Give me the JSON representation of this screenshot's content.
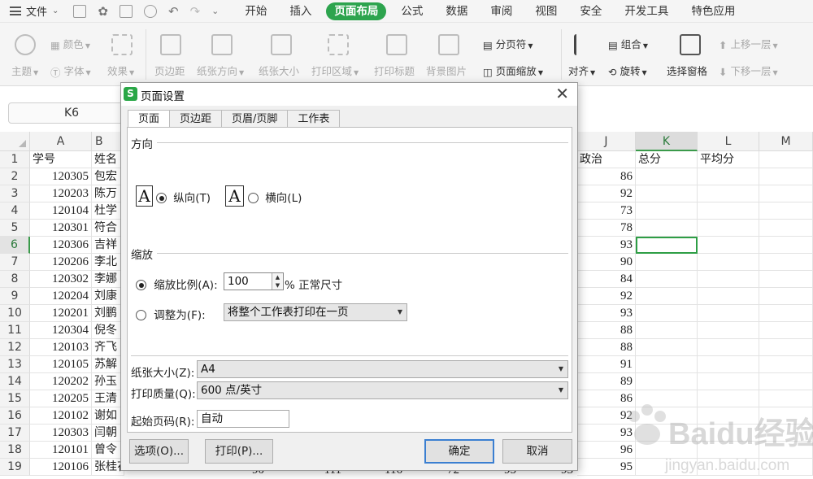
{
  "menubar": {
    "file_label": "文件",
    "tabs": [
      "开始",
      "插入",
      "页面布局",
      "公式",
      "数据",
      "审阅",
      "视图",
      "安全",
      "开发工具",
      "特色应用"
    ],
    "active_tab": "页面布局"
  },
  "ribbon": {
    "theme": "主题",
    "color": "颜色",
    "font": "字体",
    "effect": "效果",
    "margins": "页边距",
    "orientation": "纸张方向",
    "size": "纸张大小",
    "print_area": "打印区域",
    "print_titles": "打印标题",
    "background": "背景图片",
    "page_break": "分页符",
    "page_scale": "页面缩放",
    "align": "对齐",
    "group": "组合",
    "rotate": "旋转",
    "selection_pane": "选择窗格",
    "bring_forward": "上移一层",
    "send_backward": "下移一层"
  },
  "namebox": "K6",
  "sheet": {
    "columns": [
      "A",
      "B",
      "J",
      "K",
      "L",
      "M"
    ],
    "selected_column": "K",
    "selected_row": "6",
    "header_row": {
      "A": "学号",
      "B": "姓名",
      "J": "政治",
      "K": "总分",
      "L": "平均分"
    },
    "rows": [
      {
        "n": "2",
        "id": "120305",
        "name": "包宏",
        "politics": "86"
      },
      {
        "n": "3",
        "id": "120203",
        "name": "陈万",
        "politics": "92"
      },
      {
        "n": "4",
        "id": "120104",
        "name": "杜学",
        "politics": "73"
      },
      {
        "n": "5",
        "id": "120301",
        "name": "符合",
        "politics": "78"
      },
      {
        "n": "6",
        "id": "120306",
        "name": "吉祥",
        "politics": "93"
      },
      {
        "n": "7",
        "id": "120206",
        "name": "李北",
        "politics": "90"
      },
      {
        "n": "8",
        "id": "120302",
        "name": "李娜",
        "politics": "84"
      },
      {
        "n": "9",
        "id": "120204",
        "name": "刘康",
        "politics": "92"
      },
      {
        "n": "10",
        "id": "120201",
        "name": "刘鹏",
        "politics": "93"
      },
      {
        "n": "11",
        "id": "120304",
        "name": "倪冬",
        "politics": "88"
      },
      {
        "n": "12",
        "id": "120103",
        "name": "齐飞",
        "politics": "88"
      },
      {
        "n": "13",
        "id": "120105",
        "name": "苏解",
        "politics": "91"
      },
      {
        "n": "14",
        "id": "120202",
        "name": "孙玉",
        "politics": "89"
      },
      {
        "n": "15",
        "id": "120205",
        "name": "王清",
        "politics": "86"
      },
      {
        "n": "16",
        "id": "120102",
        "name": "谢如",
        "politics": "92"
      },
      {
        "n": "17",
        "id": "120303",
        "name": "闫朝",
        "politics": "93"
      },
      {
        "n": "18",
        "id": "120101",
        "name": "曾令",
        "politics": "96"
      },
      {
        "n": "19",
        "id": "120106",
        "name": "张桂花",
        "politics": "95"
      }
    ],
    "row19_extra": [
      "90",
      "111",
      "116",
      "72",
      "95",
      "93"
    ]
  },
  "dialog": {
    "title": "页面设置",
    "tabs": [
      "页面",
      "页边距",
      "页眉/页脚",
      "工作表"
    ],
    "active_tab": "页面",
    "orientation_section": "方向",
    "portrait": "纵向(T)",
    "landscape": "横向(L)",
    "page_glyph": "A",
    "scaling_section": "缩放",
    "scale_ratio_label": "缩放比例(A):",
    "scale_value": "100",
    "scale_suffix": "% 正常尺寸",
    "fit_label": "调整为(F):",
    "fit_value": "将整个工作表打印在一页",
    "paper_size_label": "纸张大小(Z):",
    "paper_size_value": "A4",
    "print_quality_label": "打印质量(Q):",
    "print_quality_value": "600 点/英寸",
    "first_page_label": "起始页码(R):",
    "first_page_value": "自动",
    "options_button": "选项(O)...",
    "print_button": "打印(P)...",
    "ok_button": "确定",
    "cancel_button": "取消"
  },
  "watermark": {
    "main": "Baidu经验",
    "sub": "jingyan.baidu.com"
  }
}
